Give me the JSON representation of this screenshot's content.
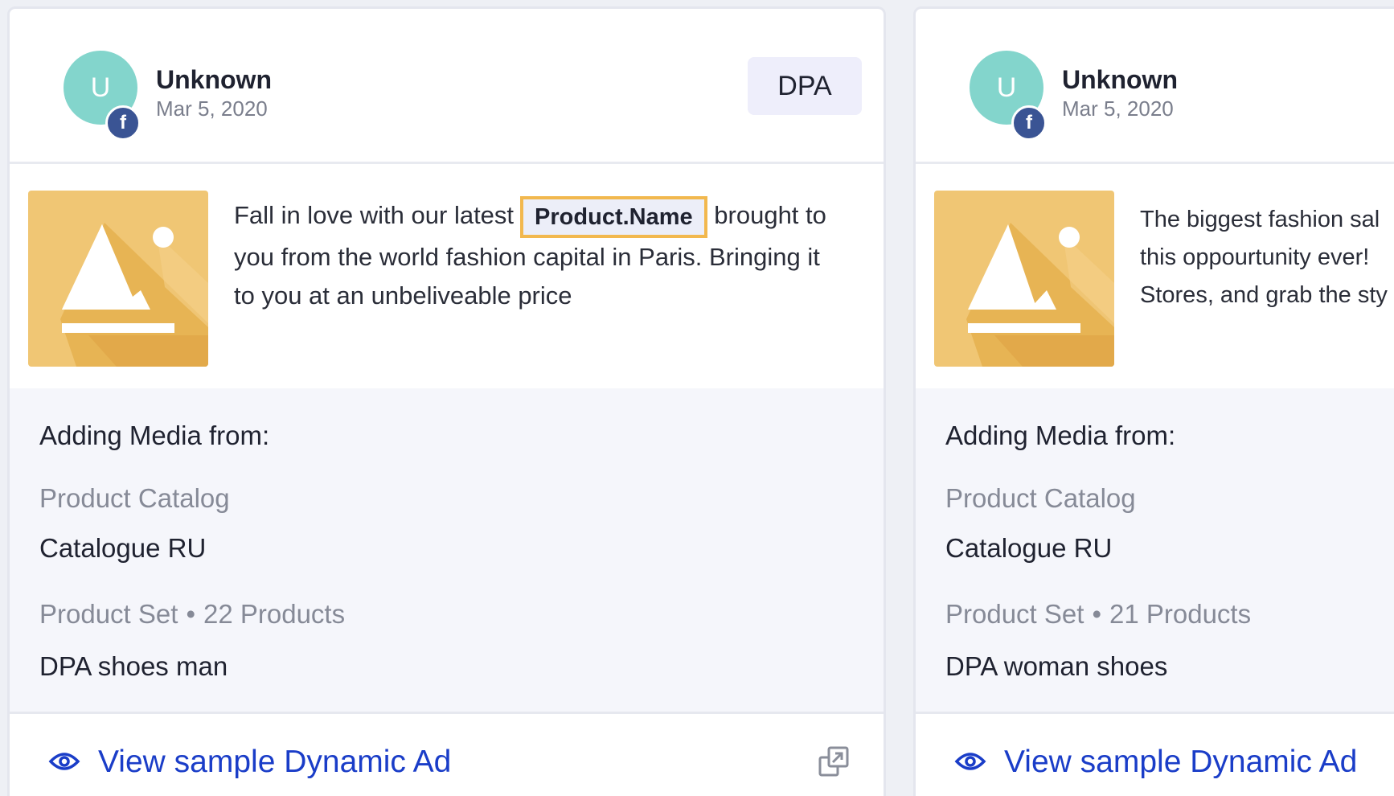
{
  "cards": [
    {
      "author": "Unknown",
      "avatar_initial": "U",
      "fb_badge": "f",
      "date": "Mar 5, 2020",
      "badge": "DPA",
      "ad_text_before": "Fall in love with our latest",
      "ad_placeholder": "Product.Name",
      "ad_text_after": "brought to you from the world fashion capital in Paris. Bringing it to you at an unbeliveable price",
      "media_heading": "Adding Media from:",
      "catalog_label": "Product Catalog",
      "catalog_value": "Catalogue RU",
      "set_label": "Product Set",
      "set_separator": "•",
      "set_count": "22 Products",
      "set_value": "DPA shoes man",
      "view_link": "View sample Dynamic Ad",
      "eye_icon": "eye-icon",
      "external_icon": "external-link-icon"
    },
    {
      "author": "Unknown",
      "avatar_initial": "U",
      "fb_badge": "f",
      "date": "Mar 5, 2020",
      "ad_line1": "The biggest fashion sal",
      "ad_line2": "this oppourtunity ever!",
      "ad_line3": "Stores, and grab the sty",
      "media_heading": "Adding Media from:",
      "catalog_label": "Product Catalog",
      "catalog_value": "Catalogue RU",
      "set_label": "Product Set",
      "set_separator": "•",
      "set_count": "21 Products",
      "set_value": "DPA woman shoes",
      "view_link": "View sample Dynamic Ad",
      "eye_icon": "eye-icon"
    }
  ],
  "colors": {
    "avatar": "#83d5cc",
    "facebook": "#3a5494",
    "placeholder_border": "#f2b84e",
    "link": "#1a3dc8",
    "thumb_bg": "#f0c674"
  }
}
